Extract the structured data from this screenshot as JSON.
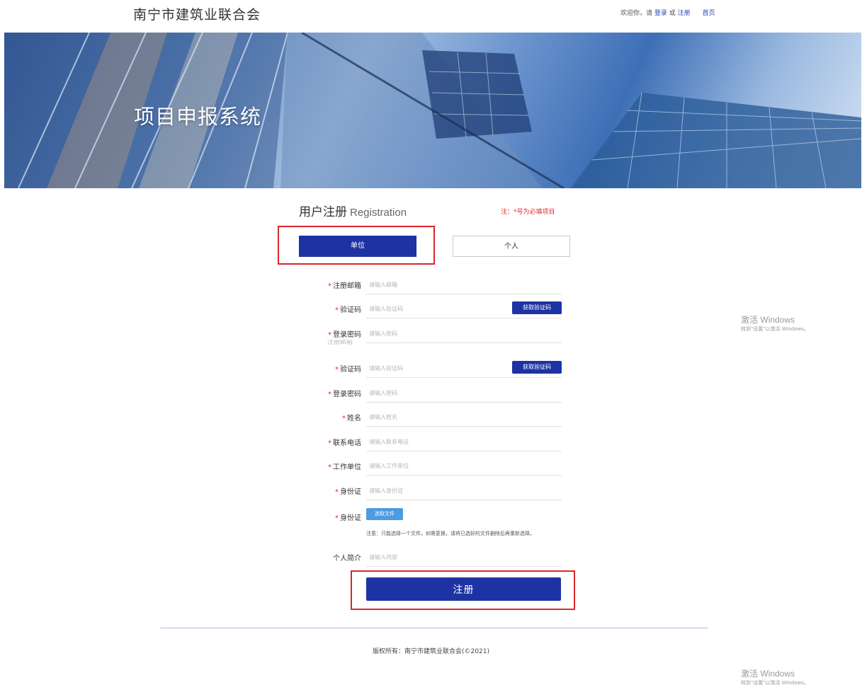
{
  "header": {
    "site_title": "南宁市建筑业联合会",
    "welcome": "欢迎你，请",
    "login": "登录",
    "or": "或",
    "register": "注册",
    "home": "首页"
  },
  "banner": {
    "title": "项目申报系统"
  },
  "registration": {
    "heading": "用户注册",
    "heading_en": "Registration",
    "required_note": "注：*号为必填项目",
    "tabs": [
      "单位",
      "个人"
    ],
    "ghost_label": "注册邮箱",
    "fields": [
      {
        "label": "注册邮箱",
        "placeholder": "请输入邮箱",
        "required": "*"
      },
      {
        "label": "验证码",
        "placeholder": "请输入验证码",
        "required": "*",
        "button": "获取验证码"
      },
      {
        "label": "登录密码",
        "placeholder": "请输入密码",
        "required": "*"
      },
      {
        "label": "验证码",
        "placeholder": "请输入验证码",
        "required": "*",
        "button": "获取验证码"
      },
      {
        "label": "登录密码",
        "placeholder": "请输入密码",
        "required": "*"
      },
      {
        "label": "姓名",
        "placeholder": "请输入姓名",
        "required": "*"
      },
      {
        "label": "联系电话",
        "placeholder": "请输入联系电话",
        "required": "*"
      },
      {
        "label": "工作单位",
        "placeholder": "请输入工作单位",
        "required": "*"
      },
      {
        "label": "身份证",
        "placeholder": "请输入身份证",
        "required": "*"
      },
      {
        "label": "身份证",
        "required": "*",
        "file_button": "选取文件"
      },
      {
        "label": "个人简介",
        "placeholder": "请输入内容",
        "required": ""
      }
    ],
    "file_note": "注意：只能选择一个文件。如需更换，请将已选好的文件删除后再重新选择。",
    "submit": "注册"
  },
  "footer": {
    "copyright": "版权所有：南宁市建筑业联合会(©2021)"
  },
  "watermark": {
    "title": "激活 Windows",
    "subtitle": "转到\"设置\"以激活 Windows。"
  },
  "colors": {
    "primary": "#1e33a3",
    "required": "#e02b2b",
    "highlight": "#d9262c",
    "file_button": "#4d9be0"
  }
}
